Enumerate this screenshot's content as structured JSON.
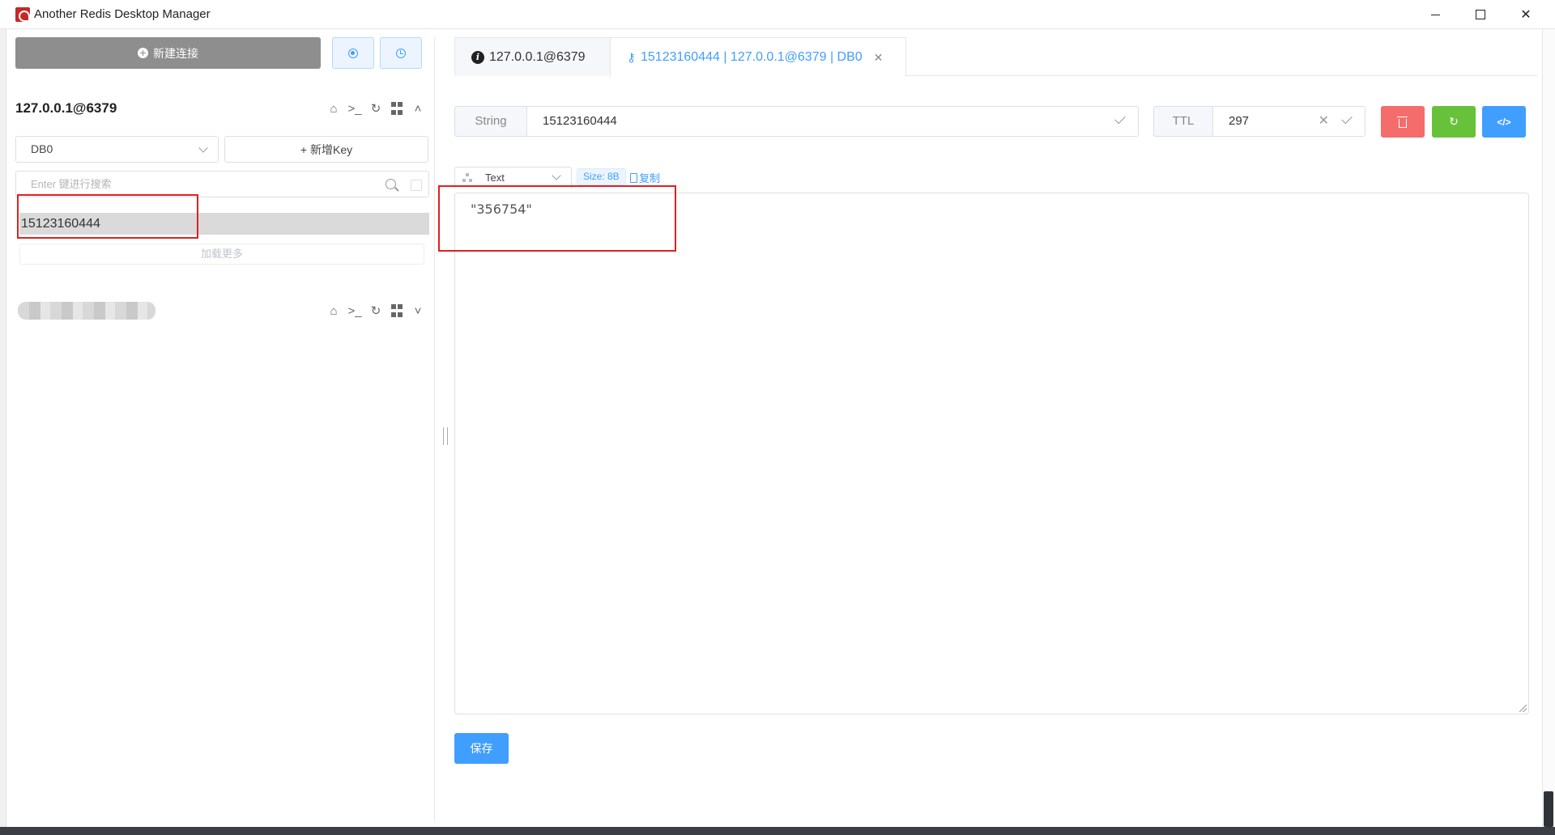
{
  "window": {
    "title": "Another Redis Desktop Manager",
    "minimize": "",
    "maximize": "",
    "close": "✕"
  },
  "sidebar": {
    "new_connection_label": "新建连接",
    "connection": {
      "name": "127.0.0.1@6379",
      "db_selected": "DB0",
      "add_key_label": "新增Key",
      "search_placeholder": "Enter 键进行搜索",
      "keys": [
        "15123160444"
      ],
      "load_more_label": "加载更多"
    }
  },
  "tabs": [
    {
      "label": "127.0.0.1@6379",
      "icon": "info-icon",
      "active": false
    },
    {
      "label": "15123160444 | 127.0.0.1@6379 | DB0",
      "icon": "key-icon",
      "active": true,
      "closable": true
    }
  ],
  "key_detail": {
    "type": "String",
    "key_name": "15123160444",
    "ttl_label": "TTL",
    "ttl_value": "297",
    "format": "Text",
    "size": "Size: 8B",
    "copy_label": "复制",
    "value": "\"356754\"",
    "save_label": "保存"
  },
  "colors": {
    "primary": "#409eff",
    "danger": "#f56c6c",
    "success": "#67c23a",
    "highlight": "#e02020"
  }
}
